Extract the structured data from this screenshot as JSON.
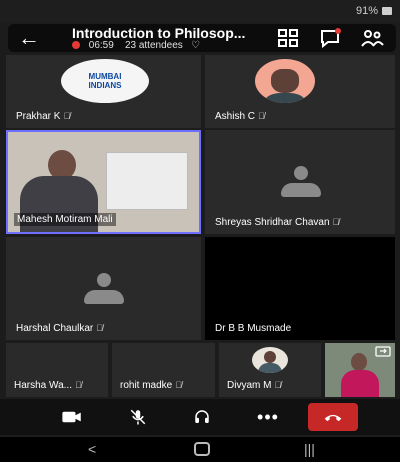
{
  "status": {
    "battery": "91%"
  },
  "header": {
    "title": "Introduction to Philosop...",
    "elapsed": "06:59",
    "attendees": "23 attendees"
  },
  "participants": {
    "p1": {
      "name": "Prakhar K",
      "logo": "MUMBAI INDIANS"
    },
    "p2": {
      "name": "Ashish C"
    },
    "p3": {
      "name": "Mahesh Motiram Mali"
    },
    "p4": {
      "name": "Shreyas Shridhar Chavan"
    },
    "p5": {
      "name": "Harshal Chaulkar"
    },
    "p6": {
      "name": "Dr B B Musmade"
    },
    "p7": {
      "name": "Harsha Wa..."
    },
    "p8": {
      "name": "rohit madke"
    },
    "p9": {
      "name": "Divyam M"
    }
  },
  "colors": {
    "end_call": "#c62828",
    "active_speaker_border": "#6f6fff"
  },
  "icons": [
    "back-arrow",
    "grid-view",
    "chat",
    "people",
    "camera",
    "mic-off",
    "headset",
    "more",
    "end-call",
    "switch-camera"
  ]
}
